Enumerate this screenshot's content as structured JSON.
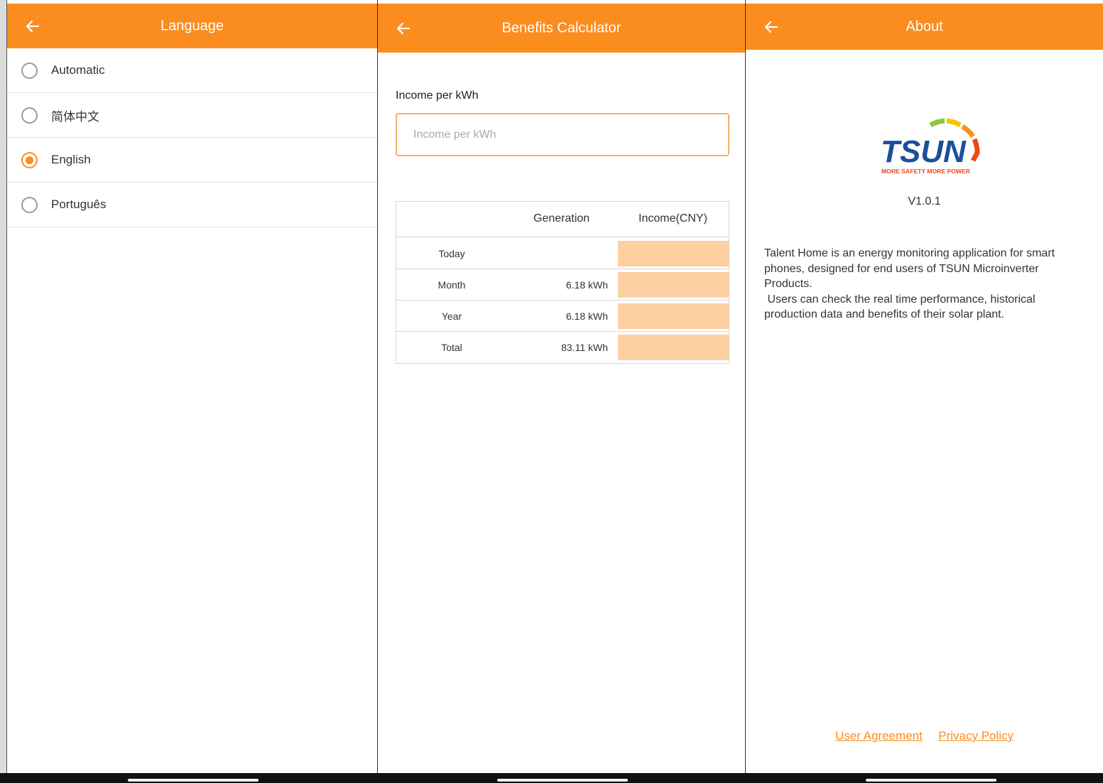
{
  "language_screen": {
    "title": "Language",
    "options": [
      {
        "label": "Automatic",
        "selected": false
      },
      {
        "label": "简体中文",
        "selected": false
      },
      {
        "label": "English",
        "selected": true
      },
      {
        "label": "Português",
        "selected": false
      }
    ]
  },
  "benefits_screen": {
    "title": "Benefits Calculator",
    "income_label": "Income per kWh",
    "income_placeholder": "Income per kWh",
    "income_value": "",
    "table": {
      "headers": {
        "generation": "Generation",
        "income": "Income(CNY)"
      },
      "rows": [
        {
          "label": "Today",
          "generation": "",
          "income": ""
        },
        {
          "label": "Month",
          "generation": "6.18 kWh",
          "income": ""
        },
        {
          "label": "Year",
          "generation": "6.18 kWh",
          "income": ""
        },
        {
          "label": "Total",
          "generation": "83.11 kWh",
          "income": ""
        }
      ]
    }
  },
  "about_screen": {
    "title": "About",
    "logo_text": "TSUN",
    "logo_tagline": "MORE SAFETY MORE POWER",
    "version": "V1.0.1",
    "description_1": "Talent Home is an energy monitoring application for smart phones, designed for end users of TSUN Microinverter Products.",
    "description_2": " Users can check the real time performance, historical production data and benefits of their solar plant.",
    "links": {
      "user_agreement": "User Agreement",
      "privacy_policy": "Privacy Policy"
    }
  },
  "icons": {
    "back": "arrow-left-icon",
    "radio": "radio-button-icon"
  },
  "colors": {
    "accent": "#fb8c1e",
    "income_cell": "#fecfa0",
    "input_border": "#f6b26b"
  }
}
